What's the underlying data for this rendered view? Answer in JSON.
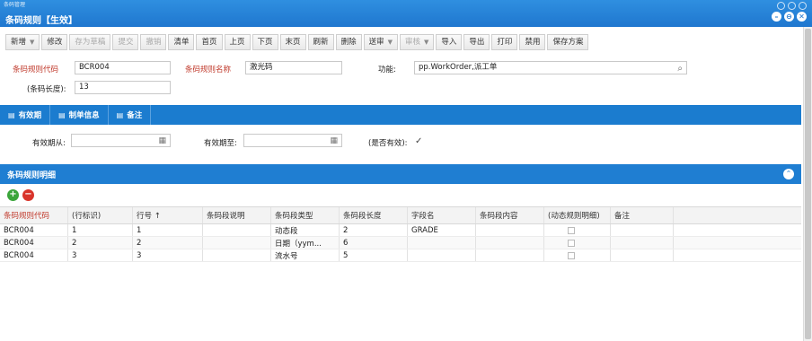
{
  "app": {
    "name": "条码管理"
  },
  "window": {
    "title": "条码规则【生效】",
    "minimize": "–",
    "restore": "⊖",
    "close": "✕"
  },
  "toolbar": {
    "buttons": [
      {
        "label": "新增",
        "dropdown": true,
        "disabled": false
      },
      {
        "label": "修改",
        "disabled": false
      },
      {
        "label": "存为草稿",
        "disabled": true
      },
      {
        "label": "提交",
        "disabled": true
      },
      {
        "label": "撤销",
        "disabled": true
      },
      {
        "label": "清单",
        "disabled": false
      },
      {
        "label": "首页",
        "disabled": false
      },
      {
        "label": "上页",
        "disabled": false
      },
      {
        "label": "下页",
        "disabled": false
      },
      {
        "label": "末页",
        "disabled": false
      },
      {
        "label": "刷新",
        "disabled": false
      },
      {
        "label": "删除",
        "disabled": false
      },
      {
        "label": "送审",
        "dropdown": true,
        "disabled": false
      },
      {
        "label": "审核",
        "dropdown": true,
        "disabled": true
      },
      {
        "label": "导入",
        "disabled": false
      },
      {
        "label": "导出",
        "disabled": false
      },
      {
        "label": "打印",
        "disabled": false
      },
      {
        "label": "禁用",
        "disabled": false
      },
      {
        "label": "保存方案",
        "disabled": false
      }
    ]
  },
  "form": {
    "code_label": "条码规则代码",
    "code_value": "BCR004",
    "name_label": "条码规则名称",
    "name_value": "激光码",
    "func_label": "功能:",
    "func_value": "pp.WorkOrder,派工单",
    "length_label": "(条码长度):",
    "length_value": "13"
  },
  "tabs": [
    {
      "label": "有效期"
    },
    {
      "label": "制单信息"
    },
    {
      "label": "备注"
    }
  ],
  "validity": {
    "from_label": "有效期从:",
    "from_value": "",
    "to_label": "有效期至:",
    "to_value": "",
    "active_label": "(是否有效):",
    "active_checked": true
  },
  "detail": {
    "title": "条码规则明细",
    "columns": [
      "条码规则代码",
      "(行标识)",
      "行号 ↑",
      "条码段说明",
      "条码段类型",
      "条码段长度",
      "字段名",
      "条码段内容",
      "(动态规则明细)",
      "备注"
    ],
    "rows": [
      {
        "code": "BCR004",
        "rowid": "1",
        "lineno": "1",
        "desc": "",
        "type": "动态段",
        "length": "2",
        "field": "GRADE",
        "content": "",
        "dynamic": false,
        "remark": ""
      },
      {
        "code": "BCR004",
        "rowid": "2",
        "lineno": "2",
        "desc": "",
        "type": "日期（yym...",
        "length": "6",
        "field": "",
        "content": "",
        "dynamic": false,
        "remark": ""
      },
      {
        "code": "BCR004",
        "rowid": "3",
        "lineno": "3",
        "desc": "",
        "type": "流水号",
        "length": "5",
        "field": "",
        "content": "",
        "dynamic": false,
        "remark": ""
      }
    ]
  },
  "colors": {
    "accent": "#1f7ed2",
    "required": "#c0392b",
    "add": "#3aa53a",
    "delete": "#d9342b"
  }
}
